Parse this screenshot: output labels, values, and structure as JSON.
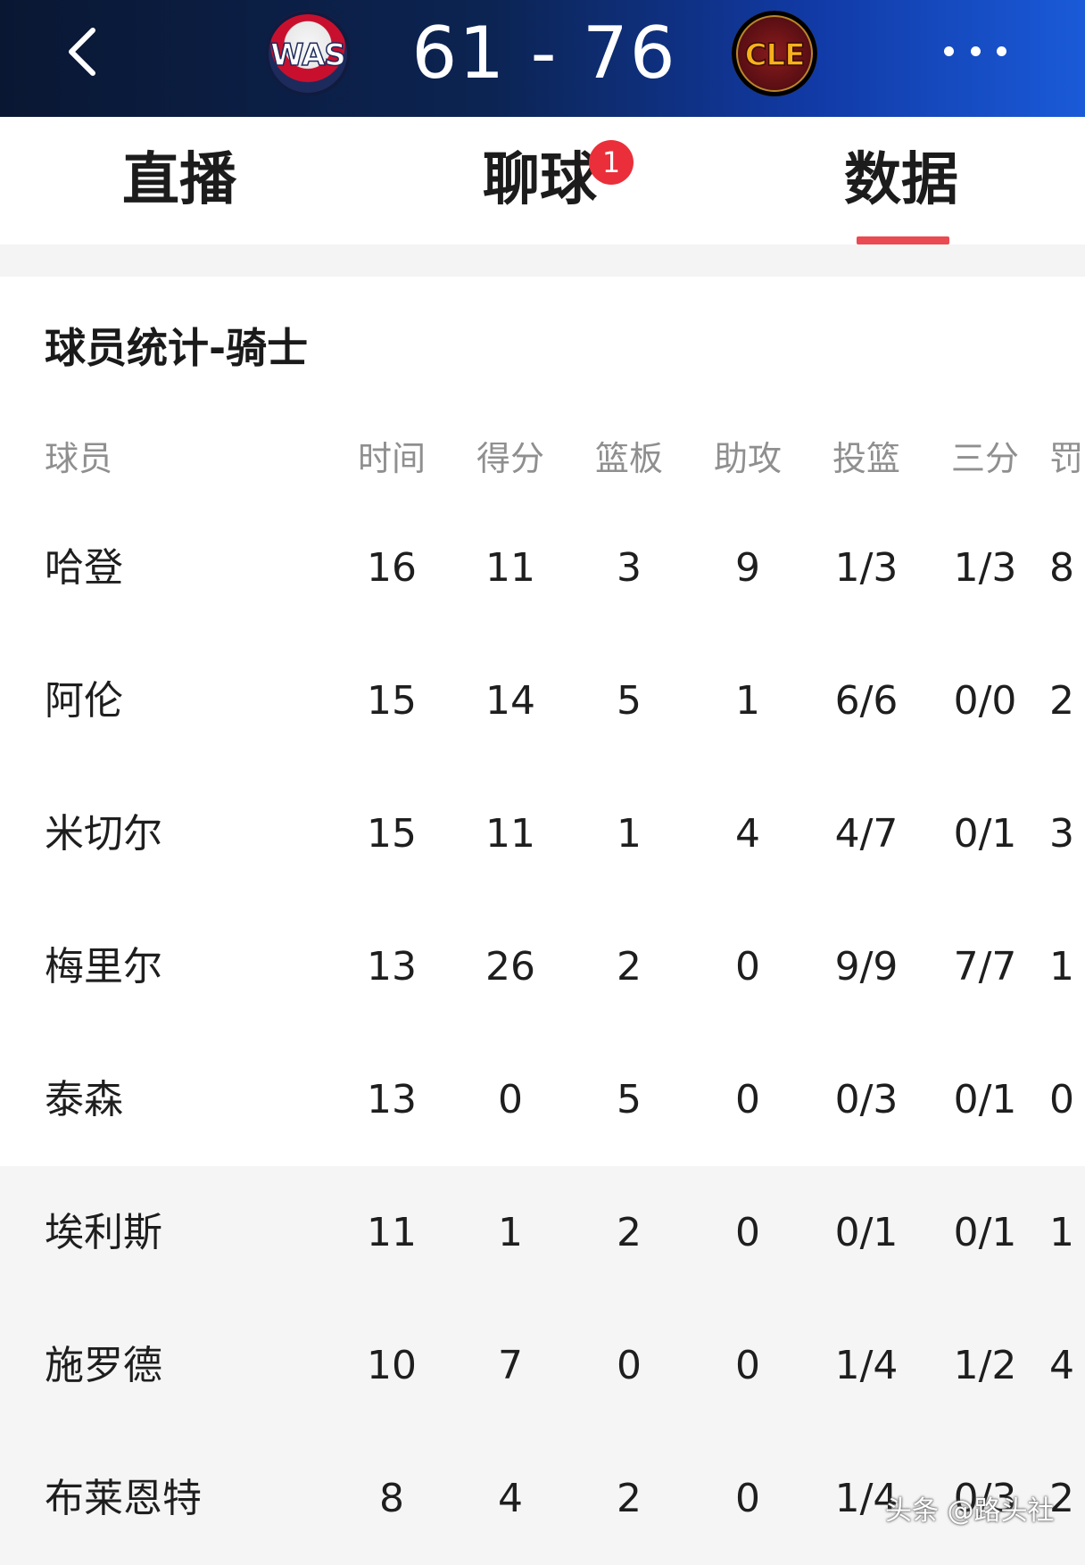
{
  "header": {
    "home_team": "WAS",
    "away_team": "CLE",
    "home_score": "61",
    "away_score": "76",
    "score_separator": "-"
  },
  "tabs": [
    {
      "label": "直播"
    },
    {
      "label": "聊球",
      "badge": "1"
    },
    {
      "label": "数据",
      "active": true
    }
  ],
  "section_title": "球员统计-骑士",
  "columns": [
    "球员",
    "时间",
    "得分",
    "篮板",
    "助攻",
    "投篮",
    "三分",
    "罚"
  ],
  "rows": [
    {
      "name": "哈登",
      "min": "16",
      "pts": "11",
      "reb": "3",
      "ast": "9",
      "fg": "1/3",
      "three": "1/3",
      "ft": "8"
    },
    {
      "name": "阿伦",
      "min": "15",
      "pts": "14",
      "reb": "5",
      "ast": "1",
      "fg": "6/6",
      "three": "0/0",
      "ft": "2"
    },
    {
      "name": "米切尔",
      "min": "15",
      "pts": "11",
      "reb": "1",
      "ast": "4",
      "fg": "4/7",
      "three": "0/1",
      "ft": "3"
    },
    {
      "name": "梅里尔",
      "min": "13",
      "pts": "26",
      "reb": "2",
      "ast": "0",
      "fg": "9/9",
      "three": "7/7",
      "ft": "1"
    },
    {
      "name": "泰森",
      "min": "13",
      "pts": "0",
      "reb": "5",
      "ast": "0",
      "fg": "0/3",
      "three": "0/1",
      "ft": "0"
    },
    {
      "name": "埃利斯",
      "min": "11",
      "pts": "1",
      "reb": "2",
      "ast": "0",
      "fg": "0/1",
      "three": "0/1",
      "ft": "1"
    },
    {
      "name": "施罗德",
      "min": "10",
      "pts": "7",
      "reb": "0",
      "ast": "0",
      "fg": "1/4",
      "three": "1/2",
      "ft": "4"
    },
    {
      "name": "布莱恩特",
      "min": "8",
      "pts": "4",
      "reb": "2",
      "ast": "0",
      "fg": "1/4",
      "three": "0/3",
      "ft": "2"
    }
  ],
  "watermark": "头条 @路头社",
  "colors": {
    "accent": "#ea4a52",
    "header_bg": "#0c2452",
    "badge": "#ea2f3a"
  },
  "icons": {
    "back": "chevron-left-icon",
    "more": "more-dots-icon"
  }
}
